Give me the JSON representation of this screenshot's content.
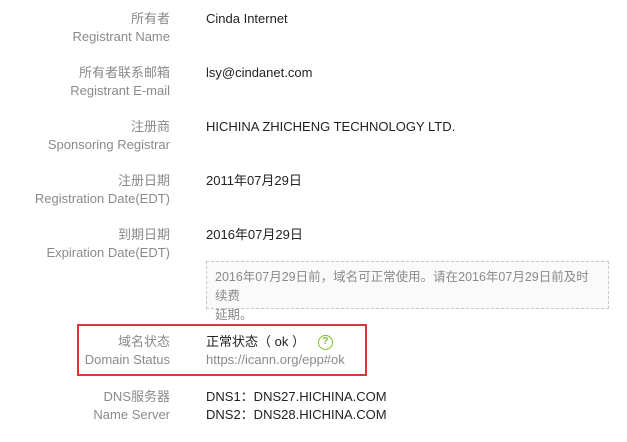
{
  "registrant": {
    "label_cn": "所有者",
    "label_en": "Registrant Name",
    "value": "Cinda Internet"
  },
  "email": {
    "label_cn": "所有者联系邮箱",
    "label_en": "Registrant E-mail",
    "value": "lsy@cindanet.com"
  },
  "registrar": {
    "label_cn": "注册商",
    "label_en": "Sponsoring Registrar",
    "value": "HICHINA ZHICHENG TECHNOLOGY LTD."
  },
  "registration": {
    "label_cn": "注册日期",
    "label_en": "Registration Date(EDT)",
    "value": "2011年07月29日"
  },
  "expiration": {
    "label_cn": "到期日期",
    "label_en": "Expiration Date(EDT)",
    "value": "2016年07月29日",
    "notice_line1": "2016年07月29日前，域名可正常使用。请在2016年07月29日前及时续费",
    "notice_line2": "延期。"
  },
  "status": {
    "label_cn": "域名状态",
    "label_en": "Domain Status",
    "value": "正常状态（ ok ）",
    "link": "https://icann.org/epp#ok",
    "help_icon": "question-circle-icon",
    "help_glyph": "?",
    "highlight_color": "#d9383a",
    "icon_color": "#7cbf2a"
  },
  "nameserver": {
    "label_cn": "DNS服务器",
    "label_en": "Name Server",
    "ns1": "DNS1：DNS27.HICHINA.COM",
    "ns2": "DNS2：DNS28.HICHINA.COM"
  }
}
